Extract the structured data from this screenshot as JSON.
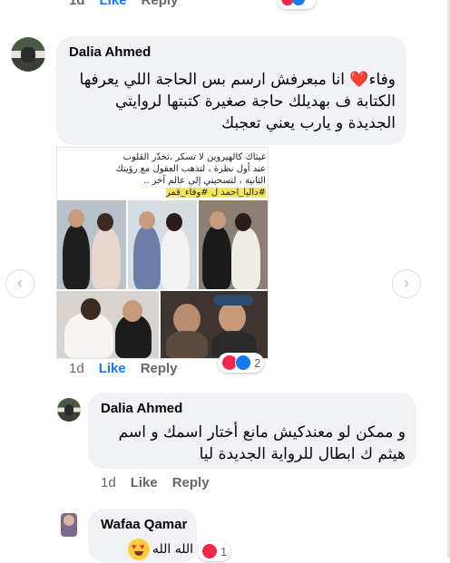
{
  "top_comment": {
    "like_label": "Like",
    "reply_label": "Reply",
    "time": "1d"
  },
  "comments": [
    {
      "author": "Dalia Ahmed",
      "text": "وفاء❤️ انا مبعرفش ارسم بس الحاجة اللي يعرفها الكتابة ف بهديلك حاجة صغيرة كتبتها لروايتي الجديدة و يارب يعني تعجبك",
      "time": "1d",
      "like_label": "Like",
      "reply_label": "Reply",
      "reactions": [
        "heart",
        "like"
      ],
      "reaction_count": "2",
      "image_caption_line1": "غيثاك كالهيروين لا تسكر ،تخدّر القلوب",
      "image_caption_line2": "عند أول نظرة ، لتذهب العقول مع رؤيتك",
      "image_caption_line3": "الثانية ، لتسحبني إلى عالم آخر ..",
      "image_caption_tag": "#داليا_احمد ل #وفاء_قمر"
    },
    {
      "author": "Dalia Ahmed",
      "text": "و ممكن لو معندكيش مانع أختار اسمك و اسم هيثم ك ابطال للرواية الجديدة ليا",
      "time": "1d",
      "like_label": "Like",
      "reply_label": "Reply"
    },
    {
      "author": "Wafaa Qamar",
      "text": "الله الله",
      "reaction_count": "1"
    }
  ],
  "colors": {
    "like_blue": "#1877f2",
    "bubble": "#f0f2f5",
    "meta_gray": "#65676b",
    "heart_red": "#f02849"
  }
}
